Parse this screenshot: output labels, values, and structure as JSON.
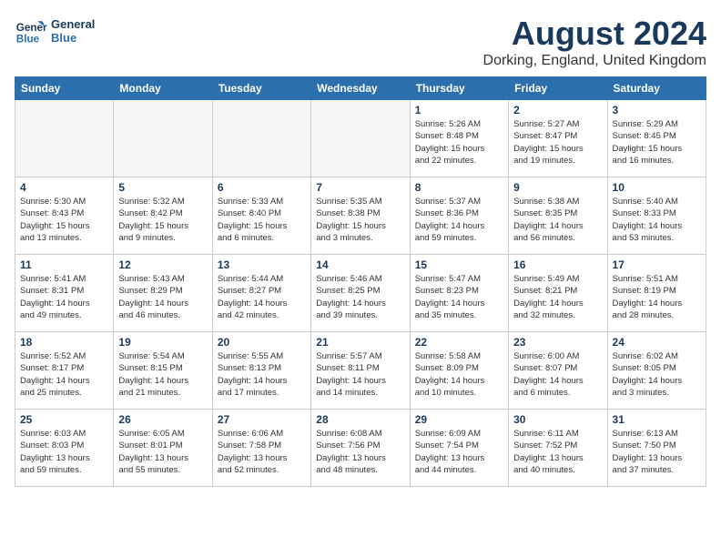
{
  "header": {
    "logo_line1": "General",
    "logo_line2": "Blue",
    "month_year": "August 2024",
    "location": "Dorking, England, United Kingdom"
  },
  "days_of_week": [
    "Sunday",
    "Monday",
    "Tuesday",
    "Wednesday",
    "Thursday",
    "Friday",
    "Saturday"
  ],
  "weeks": [
    [
      {
        "day": "",
        "empty": true
      },
      {
        "day": "",
        "empty": true
      },
      {
        "day": "",
        "empty": true
      },
      {
        "day": "",
        "empty": true
      },
      {
        "day": "1",
        "info": "Sunrise: 5:26 AM\nSunset: 8:48 PM\nDaylight: 15 hours\nand 22 minutes."
      },
      {
        "day": "2",
        "info": "Sunrise: 5:27 AM\nSunset: 8:47 PM\nDaylight: 15 hours\nand 19 minutes."
      },
      {
        "day": "3",
        "info": "Sunrise: 5:29 AM\nSunset: 8:45 PM\nDaylight: 15 hours\nand 16 minutes."
      }
    ],
    [
      {
        "day": "4",
        "info": "Sunrise: 5:30 AM\nSunset: 8:43 PM\nDaylight: 15 hours\nand 13 minutes."
      },
      {
        "day": "5",
        "info": "Sunrise: 5:32 AM\nSunset: 8:42 PM\nDaylight: 15 hours\nand 9 minutes."
      },
      {
        "day": "6",
        "info": "Sunrise: 5:33 AM\nSunset: 8:40 PM\nDaylight: 15 hours\nand 6 minutes."
      },
      {
        "day": "7",
        "info": "Sunrise: 5:35 AM\nSunset: 8:38 PM\nDaylight: 15 hours\nand 3 minutes."
      },
      {
        "day": "8",
        "info": "Sunrise: 5:37 AM\nSunset: 8:36 PM\nDaylight: 14 hours\nand 59 minutes."
      },
      {
        "day": "9",
        "info": "Sunrise: 5:38 AM\nSunset: 8:35 PM\nDaylight: 14 hours\nand 56 minutes."
      },
      {
        "day": "10",
        "info": "Sunrise: 5:40 AM\nSunset: 8:33 PM\nDaylight: 14 hours\nand 53 minutes."
      }
    ],
    [
      {
        "day": "11",
        "info": "Sunrise: 5:41 AM\nSunset: 8:31 PM\nDaylight: 14 hours\nand 49 minutes."
      },
      {
        "day": "12",
        "info": "Sunrise: 5:43 AM\nSunset: 8:29 PM\nDaylight: 14 hours\nand 46 minutes."
      },
      {
        "day": "13",
        "info": "Sunrise: 5:44 AM\nSunset: 8:27 PM\nDaylight: 14 hours\nand 42 minutes."
      },
      {
        "day": "14",
        "info": "Sunrise: 5:46 AM\nSunset: 8:25 PM\nDaylight: 14 hours\nand 39 minutes."
      },
      {
        "day": "15",
        "info": "Sunrise: 5:47 AM\nSunset: 8:23 PM\nDaylight: 14 hours\nand 35 minutes."
      },
      {
        "day": "16",
        "info": "Sunrise: 5:49 AM\nSunset: 8:21 PM\nDaylight: 14 hours\nand 32 minutes."
      },
      {
        "day": "17",
        "info": "Sunrise: 5:51 AM\nSunset: 8:19 PM\nDaylight: 14 hours\nand 28 minutes."
      }
    ],
    [
      {
        "day": "18",
        "info": "Sunrise: 5:52 AM\nSunset: 8:17 PM\nDaylight: 14 hours\nand 25 minutes."
      },
      {
        "day": "19",
        "info": "Sunrise: 5:54 AM\nSunset: 8:15 PM\nDaylight: 14 hours\nand 21 minutes."
      },
      {
        "day": "20",
        "info": "Sunrise: 5:55 AM\nSunset: 8:13 PM\nDaylight: 14 hours\nand 17 minutes."
      },
      {
        "day": "21",
        "info": "Sunrise: 5:57 AM\nSunset: 8:11 PM\nDaylight: 14 hours\nand 14 minutes."
      },
      {
        "day": "22",
        "info": "Sunrise: 5:58 AM\nSunset: 8:09 PM\nDaylight: 14 hours\nand 10 minutes."
      },
      {
        "day": "23",
        "info": "Sunrise: 6:00 AM\nSunset: 8:07 PM\nDaylight: 14 hours\nand 6 minutes."
      },
      {
        "day": "24",
        "info": "Sunrise: 6:02 AM\nSunset: 8:05 PM\nDaylight: 14 hours\nand 3 minutes."
      }
    ],
    [
      {
        "day": "25",
        "info": "Sunrise: 6:03 AM\nSunset: 8:03 PM\nDaylight: 13 hours\nand 59 minutes."
      },
      {
        "day": "26",
        "info": "Sunrise: 6:05 AM\nSunset: 8:01 PM\nDaylight: 13 hours\nand 55 minutes."
      },
      {
        "day": "27",
        "info": "Sunrise: 6:06 AM\nSunset: 7:58 PM\nDaylight: 13 hours\nand 52 minutes."
      },
      {
        "day": "28",
        "info": "Sunrise: 6:08 AM\nSunset: 7:56 PM\nDaylight: 13 hours\nand 48 minutes."
      },
      {
        "day": "29",
        "info": "Sunrise: 6:09 AM\nSunset: 7:54 PM\nDaylight: 13 hours\nand 44 minutes."
      },
      {
        "day": "30",
        "info": "Sunrise: 6:11 AM\nSunset: 7:52 PM\nDaylight: 13 hours\nand 40 minutes."
      },
      {
        "day": "31",
        "info": "Sunrise: 6:13 AM\nSunset: 7:50 PM\nDaylight: 13 hours\nand 37 minutes."
      }
    ]
  ]
}
